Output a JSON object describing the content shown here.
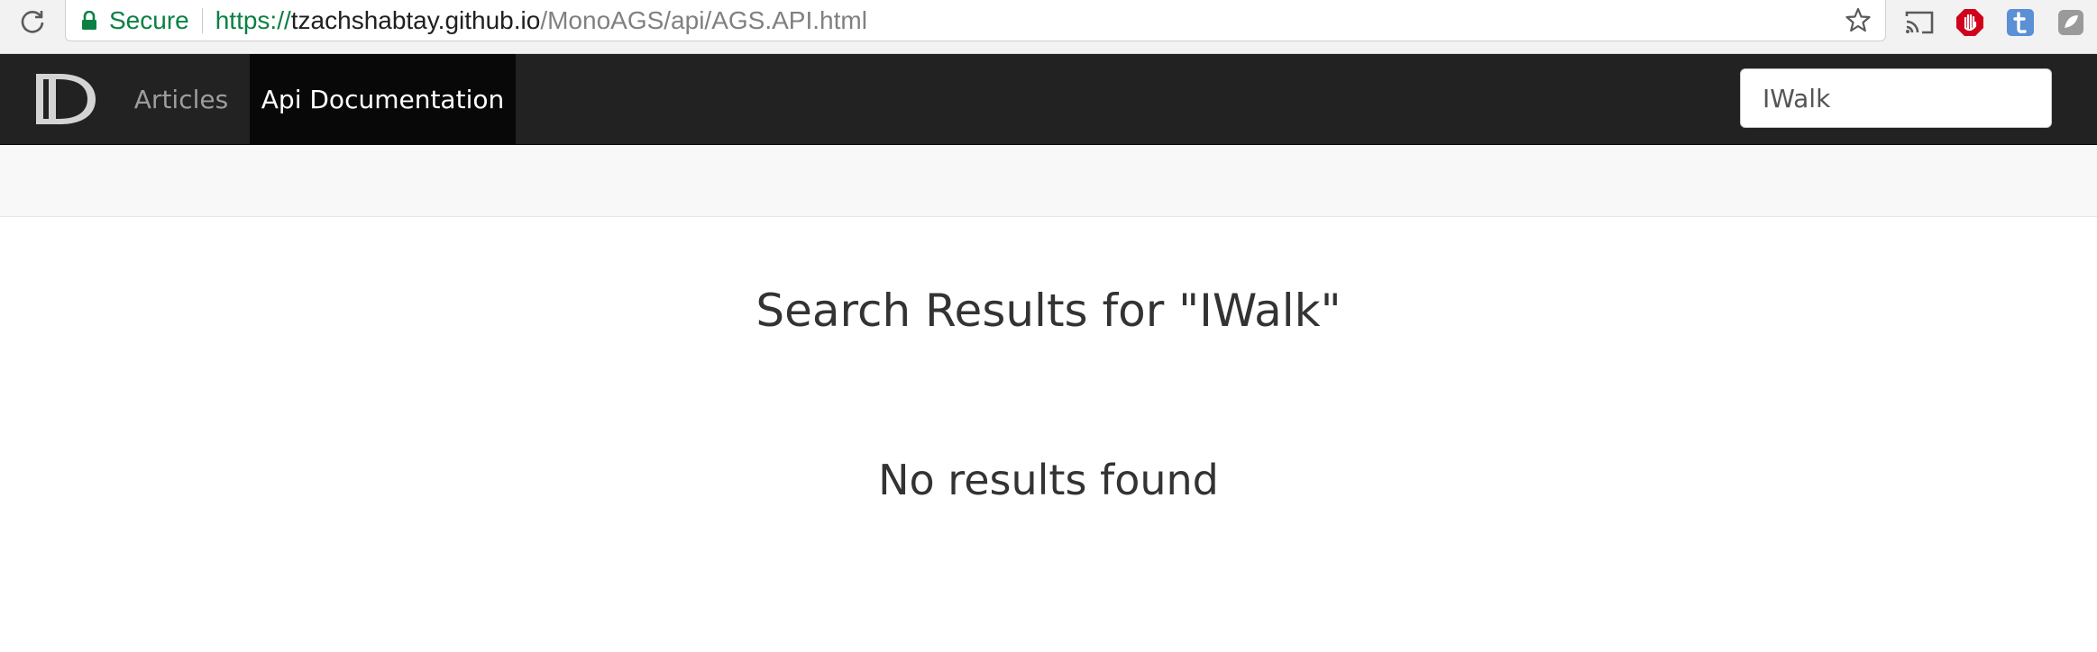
{
  "browser": {
    "secure_label": "Secure",
    "url_scheme": "https://",
    "url_host": "tzachshabtay.github.io",
    "url_path": "/MonoAGS/api/AGS.API.html",
    "icons": [
      "reload-icon",
      "lock-icon",
      "star-icon",
      "cast-icon",
      "adblock-icon",
      "tumblr-icon",
      "extension-icon"
    ]
  },
  "navbar": {
    "brand_icon": "docfx-logo-icon",
    "items": [
      {
        "label": "Articles",
        "active": false
      },
      {
        "label": "Api Documentation",
        "active": true
      }
    ],
    "search": {
      "value": "IWalk",
      "placeholder": ""
    }
  },
  "main": {
    "title": "Search Results for \"IWalk\"",
    "no_results": "No results found"
  },
  "colors": {
    "navbar_bg": "#222222",
    "active_tab_bg": "#080808",
    "secure_green": "#0b8043",
    "text": "#333333"
  }
}
